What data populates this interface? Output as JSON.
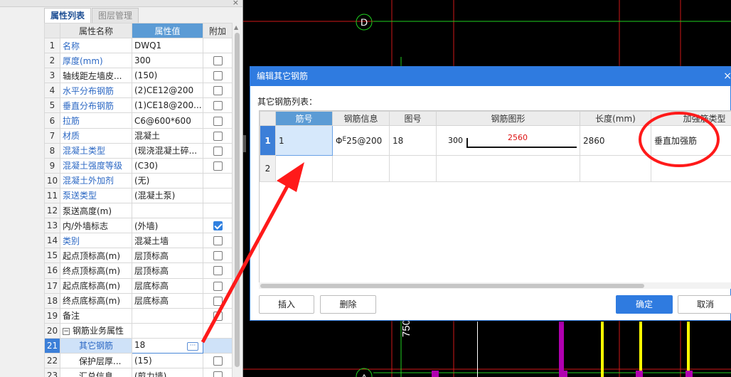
{
  "left_panel": {
    "close_glyph": "×",
    "tabs": [
      {
        "label": "属性列表"
      },
      {
        "label": "图层管理"
      }
    ],
    "headers": {
      "name": "属性名称",
      "value": "属性值",
      "add": "附加"
    },
    "rows": [
      {
        "idx": "1",
        "name": "名称",
        "value": "DWQ1",
        "blue": true,
        "check": null
      },
      {
        "idx": "2",
        "name": "厚度(mm)",
        "value": "300",
        "blue": true,
        "check": false
      },
      {
        "idx": "3",
        "name": "轴线距左墙皮...",
        "value": "(150)",
        "blue": false,
        "check": false
      },
      {
        "idx": "4",
        "name": "水平分布钢筋",
        "value": "(2)CE12@200",
        "blue": true,
        "check": false
      },
      {
        "idx": "5",
        "name": "垂直分布钢筋",
        "value": "(1)CE18@200...",
        "blue": true,
        "check": false
      },
      {
        "idx": "6",
        "name": "拉筋",
        "value": "C6@600*600",
        "blue": true,
        "check": false
      },
      {
        "idx": "7",
        "name": "材质",
        "value": "混凝土",
        "blue": true,
        "check": false
      },
      {
        "idx": "8",
        "name": "混凝土类型",
        "value": "(现浇混凝土碎...",
        "blue": true,
        "check": false
      },
      {
        "idx": "9",
        "name": "混凝土强度等级",
        "value": "(C30)",
        "blue": true,
        "check": false
      },
      {
        "idx": "10",
        "name": "混凝土外加剂",
        "value": "(无)",
        "blue": true,
        "check": null
      },
      {
        "idx": "11",
        "name": "泵送类型",
        "value": "(混凝土泵)",
        "blue": true,
        "check": null
      },
      {
        "idx": "12",
        "name": "泵送高度(m)",
        "value": "",
        "blue": false,
        "check": null
      },
      {
        "idx": "13",
        "name": "内/外墙标志",
        "value": "(外墙)",
        "blue": false,
        "check": true
      },
      {
        "idx": "14",
        "name": "类别",
        "value": "混凝土墙",
        "blue": true,
        "check": false
      },
      {
        "idx": "15",
        "name": "起点顶标高(m)",
        "value": "层顶标高",
        "blue": false,
        "check": false
      },
      {
        "idx": "16",
        "name": "终点顶标高(m)",
        "value": "层顶标高",
        "blue": false,
        "check": false
      },
      {
        "idx": "17",
        "name": "起点底标高(m)",
        "value": "层底标高",
        "blue": false,
        "check": false
      },
      {
        "idx": "18",
        "name": "终点底标高(m)",
        "value": "层底标高",
        "blue": false,
        "check": false
      },
      {
        "idx": "19",
        "name": "备注",
        "value": "",
        "blue": false,
        "check": false
      },
      {
        "idx": "20",
        "name": "钢筋业务属性",
        "value": "",
        "blue": false,
        "check": null,
        "group": true,
        "toggle": "−"
      },
      {
        "idx": "21",
        "name": "其它钢筋",
        "value": "18",
        "blue": true,
        "check": null,
        "indent": true,
        "selected": true,
        "ellipsis": "···"
      },
      {
        "idx": "22",
        "name": "保护层厚...",
        "value": "(15)",
        "blue": false,
        "check": false,
        "indent": true
      },
      {
        "idx": "23",
        "name": "汇总信息",
        "value": "(剪力墙)",
        "blue": false,
        "check": false,
        "indent": true
      }
    ]
  },
  "canvas": {
    "axis_labels": [
      "D",
      "A"
    ],
    "dim_text": "750"
  },
  "dialog": {
    "title": "编辑其它钢筋",
    "close_glyph": "×",
    "list_label": "其它钢筋列表：",
    "columns": [
      "筋号",
      "钢筋信息",
      "图号",
      "钢筋图形",
      "长度(mm)",
      "加强筋类型"
    ],
    "rows": [
      {
        "num": "1",
        "bar_no": "1",
        "rebar_symbol": "Φ",
        "rebar_symbol_sup": "E",
        "rebar_info": "25@200",
        "fig_no": "18",
        "shape_left": "300",
        "shape_mid": "2560",
        "length": "2860",
        "type": "垂直加强筋"
      },
      {
        "num": "2",
        "bar_no": "",
        "rebar_info": "",
        "fig_no": "",
        "length": "",
        "type": ""
      }
    ],
    "buttons": {
      "insert": "插入",
      "delete": "删除",
      "ok": "确定",
      "cancel": "取消"
    }
  },
  "colors": {
    "accent": "#2f7be0",
    "header_highlight": "#5b9bd5",
    "label_blue": "#2c68c4",
    "annotation_red": "#ff1a1a",
    "cad_green": "#1fd01f",
    "cad_yellow": "#ffff00",
    "cad_magenta": "#c000c0"
  }
}
